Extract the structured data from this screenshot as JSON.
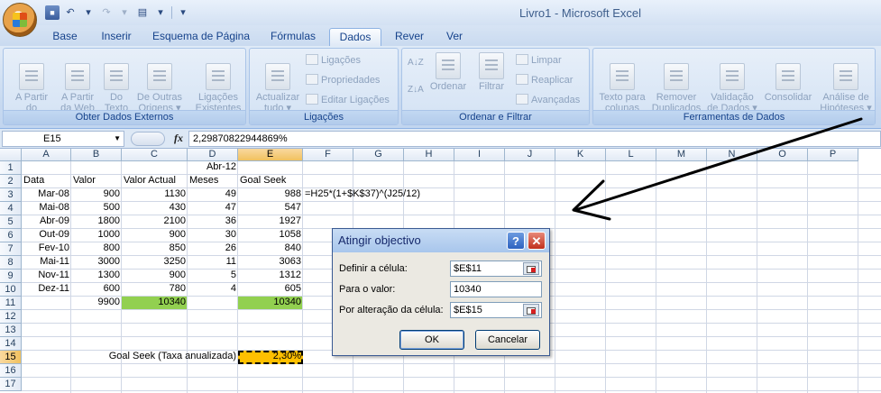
{
  "window": {
    "title": "Livro1 - Microsoft Excel"
  },
  "qat": {
    "save_icon": "save-icon",
    "undo": "↶",
    "redo": "↷",
    "customize": "▾"
  },
  "tabs": [
    "Base",
    "Inserir",
    "Esquema de Página",
    "Fórmulas",
    "Dados",
    "Rever",
    "Ver"
  ],
  "active_tab": "Dados",
  "ribbon": {
    "obter": {
      "label": "Obter Dados Externos",
      "buttons": [
        "A Partir\ndo Access",
        "A Partir\nda Web",
        "Do\nTexto",
        "De Outras\nOrigens ▾",
        "Ligações\nExistentes"
      ]
    },
    "ligacoes": {
      "label": "Ligações",
      "refresh": "Actualizar\ntudo ▾",
      "small": [
        "Ligações",
        "Propriedades",
        "Editar Ligações"
      ]
    },
    "ordenar": {
      "label": "Ordenar e Filtrar",
      "az": "A↓Z",
      "za": "Z↓A",
      "ordenar": "Ordenar",
      "filtrar": "Filtrar",
      "small": [
        "Limpar",
        "Reaplicar",
        "Avançadas"
      ]
    },
    "ferramentas": {
      "label": "Ferramentas de Dados",
      "buttons": [
        "Texto para\ncolunas",
        "Remover\nDuplicados",
        "Validação\nde Dados ▾",
        "Consolidar",
        "Análise de\nHipóteses ▾"
      ]
    }
  },
  "formula_bar": {
    "name_box": "E15",
    "fx": "fx",
    "content": "2,29870822944869%"
  },
  "grid": {
    "columns": [
      "A",
      "B",
      "C",
      "D",
      "E",
      "F",
      "G",
      "H",
      "I",
      "J",
      "K",
      "L",
      "M",
      "N",
      "O",
      "P"
    ],
    "rows": [
      "1",
      "2",
      "3",
      "4",
      "5",
      "6",
      "7",
      "8",
      "9",
      "10",
      "11",
      "12",
      "13",
      "14",
      "15",
      "16",
      "17"
    ],
    "selected_col": "E",
    "selected_row": "15",
    "cells": {
      "D1": "Abr-12",
      "A2": "Data",
      "B2": "Valor",
      "C2": "Valor Actual",
      "D2": "Meses",
      "E2": "Goal Seek",
      "A3": "Mar-08",
      "B3": "900",
      "C3": "1130",
      "D3": "49",
      "E3": "988",
      "F3": "=H25*(1+$K$37)^(J25/12)",
      "A4": "Mai-08",
      "B4": "500",
      "C4": "430",
      "D4": "47",
      "E4": "547",
      "A5": "Abr-09",
      "B5": "1800",
      "C5": "2100",
      "D5": "36",
      "E5": "1927",
      "A6": "Out-09",
      "B6": "1000",
      "C6": "900",
      "D6": "30",
      "E6": "1058",
      "A7": "Fev-10",
      "B7": "800",
      "C7": "850",
      "D7": "26",
      "E7": "840",
      "A8": "Mai-11",
      "B8": "3000",
      "C8": "3250",
      "D8": "11",
      "E8": "3063",
      "A9": "Nov-11",
      "B9": "1300",
      "C9": "900",
      "D9": "5",
      "E9": "1312",
      "A10": "Dez-11",
      "B10": "600",
      "C10": "780",
      "D10": "4",
      "E10": "605",
      "B11": "9900",
      "C11": "10340",
      "E11": "10340",
      "B15": "Goal Seek (Taxa anualizada)",
      "E15": "2,30%"
    },
    "highlight_colors": {
      "green": "#92d050",
      "orange": "#ffc000"
    }
  },
  "dialog": {
    "title": "Atingir objectivo",
    "help": "?",
    "close": "✕",
    "fields": [
      {
        "label": "Definir a célula:",
        "value": "$E$11"
      },
      {
        "label": "Para o valor:",
        "value": "10340"
      },
      {
        "label": "Por alteração da célula:",
        "value": "$E$15"
      }
    ],
    "ok": "OK",
    "cancel": "Cancelar"
  }
}
